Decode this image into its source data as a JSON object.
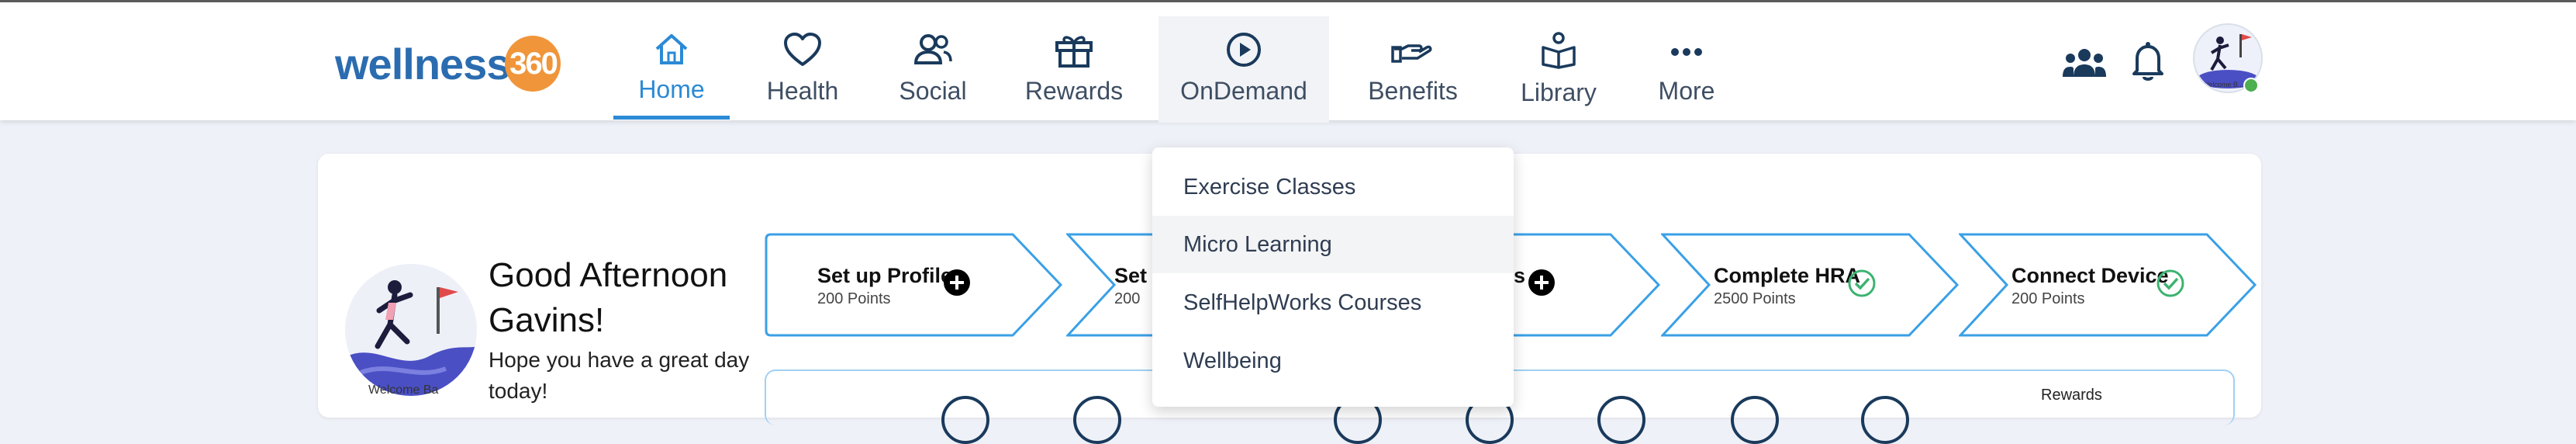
{
  "brand": {
    "name": "wellness",
    "number": "360"
  },
  "nav": [
    {
      "label": "Home",
      "icon": "home-icon",
      "active": true
    },
    {
      "label": "Health",
      "icon": "heart-icon"
    },
    {
      "label": "Social",
      "icon": "people-icon"
    },
    {
      "label": "Rewards",
      "icon": "gift-icon"
    },
    {
      "label": "OnDemand",
      "icon": "play-circle-icon",
      "expanded": true
    },
    {
      "label": "Benefits",
      "icon": "hand-coin-icon"
    },
    {
      "label": "Library",
      "icon": "book-icon"
    },
    {
      "label": "More",
      "icon": "more-dots-icon"
    }
  ],
  "header_icons": [
    "group-icon",
    "bell-icon",
    "avatar"
  ],
  "avatar_caption": "Welcome B...",
  "dropdown": {
    "items": [
      {
        "label": "Exercise Classes"
      },
      {
        "label": "Micro Learning",
        "hovered": true
      },
      {
        "label": "SelfHelpWorks Courses"
      },
      {
        "label": "Wellbeing"
      }
    ]
  },
  "welcome": {
    "image_caption": "Welcome Ba",
    "greeting": "Good Afternoon Gavins!",
    "subtext": "Hope you have a great day today!"
  },
  "steps": [
    {
      "title": "Set up Profile",
      "points": "200 Points",
      "status": "add"
    },
    {
      "title": "Set",
      "points": "200",
      "status": "add"
    },
    {
      "title": "s",
      "points": "",
      "status": "add"
    },
    {
      "title": "Complete HRA",
      "points": "2500 Points",
      "status": "done"
    },
    {
      "title": "Connect Device",
      "points": "200 Points",
      "status": "done"
    }
  ],
  "rewards_panel": {
    "label": "Rewards"
  },
  "colors": {
    "accent": "#2b8ad6",
    "brand_blue": "#2b6cb0",
    "brand_orange": "#f0953a",
    "step_border": "#3aa0e6",
    "done_green": "#3cb371"
  }
}
